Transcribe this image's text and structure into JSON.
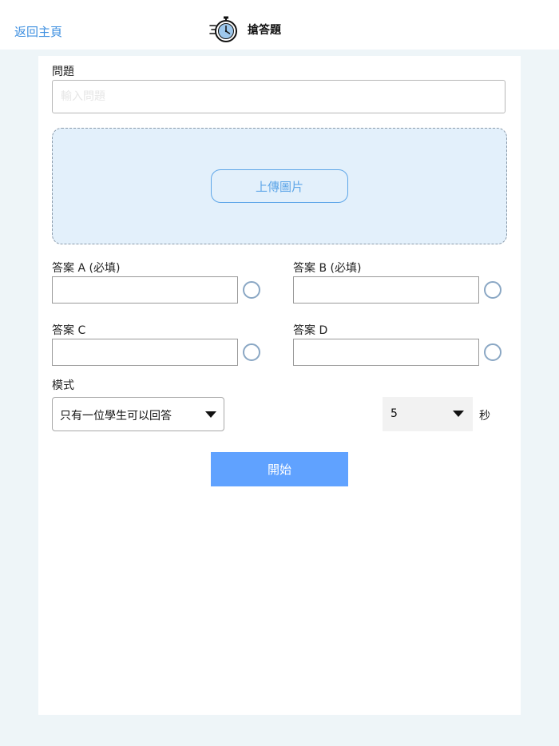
{
  "header": {
    "back_label": "返回主頁",
    "title": "搶答題",
    "title_icon": "stopwatch-icon"
  },
  "form": {
    "question": {
      "label": "問題",
      "placeholder": "輸入問題",
      "value": ""
    },
    "upload": {
      "button_label": "上傳圖片"
    },
    "answers": [
      {
        "label": "答案 A (必填)",
        "value": "",
        "selected": false
      },
      {
        "label": "答案 B (必填)",
        "value": "",
        "selected": false
      },
      {
        "label": "答案 C",
        "value": "",
        "selected": false
      },
      {
        "label": "答案 D",
        "value": "",
        "selected": false
      }
    ],
    "mode": {
      "label": "模式",
      "selected": "只有一位學生可以回答"
    },
    "seconds": {
      "selected": "5",
      "unit": "秒"
    },
    "start_label": "開始"
  },
  "colors": {
    "accent": "#60a2ff",
    "link": "#3d8fe0",
    "upload_bg": "#e3f0fb",
    "page_bg": "#eef5f8"
  }
}
